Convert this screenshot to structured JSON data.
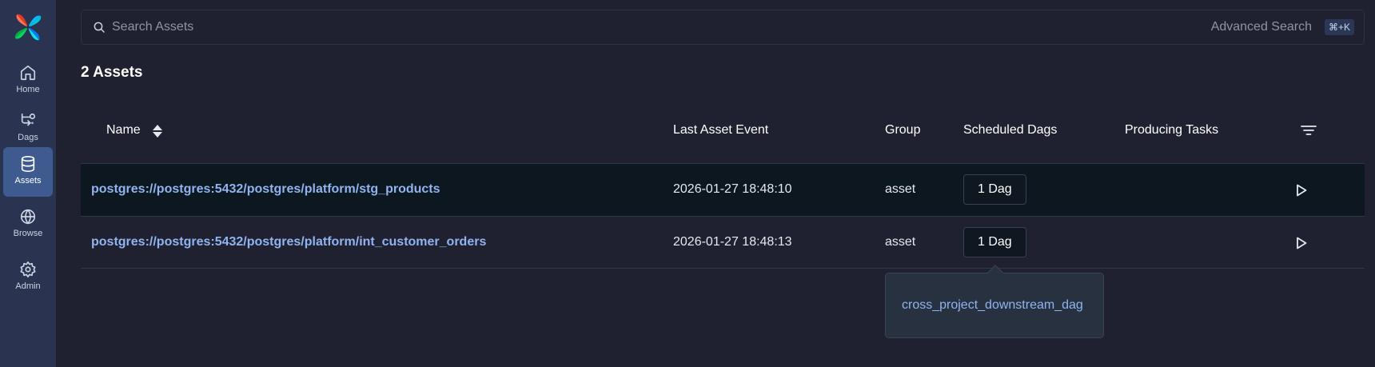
{
  "sidebar": {
    "items": [
      {
        "label": "Home",
        "icon": "home-icon"
      },
      {
        "label": "Dags",
        "icon": "dags-icon"
      },
      {
        "label": "Assets",
        "icon": "database-icon"
      },
      {
        "label": "Browse",
        "icon": "globe-icon"
      },
      {
        "label": "Admin",
        "icon": "gear-icon"
      }
    ],
    "active": "Assets"
  },
  "search": {
    "placeholder": "Search Assets",
    "value": "",
    "advanced_label": "Advanced Search",
    "shortcut": "⌘+K"
  },
  "assets_count_label": "2 Assets",
  "table": {
    "columns": {
      "name": "Name",
      "last_event": "Last Asset Event",
      "group": "Group",
      "scheduled": "Scheduled Dags",
      "producing": "Producing Tasks"
    },
    "rows": [
      {
        "name": "postgres://postgres:5432/postgres/platform/stg_products",
        "last_event": "2026-01-27 18:48:10",
        "group": "asset",
        "scheduled": "1 Dag",
        "producing": ""
      },
      {
        "name": "postgres://postgres:5432/postgres/platform/int_customer_orders",
        "last_event": "2026-01-27 18:48:13",
        "group": "asset",
        "scheduled": "1 Dag",
        "producing": ""
      }
    ]
  },
  "tooltip": {
    "dag_link": "cross_project_downstream_dag"
  },
  "colors": {
    "background": "#1f2130",
    "sidebar": "#2a3350",
    "active_nav": "#3e5a8e",
    "link": "#8fb4f0",
    "highlight_row": "#0c1720"
  }
}
